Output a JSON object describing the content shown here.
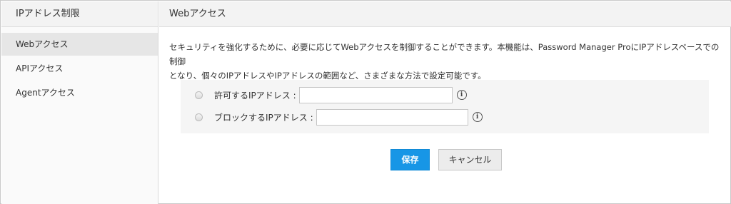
{
  "sidebar": {
    "title": "IPアドレス制限",
    "items": [
      {
        "label": "Webアクセス",
        "active": true
      },
      {
        "label": "APIアクセス",
        "active": false
      },
      {
        "label": "Agentアクセス",
        "active": false
      }
    ]
  },
  "main": {
    "title": "Webアクセス",
    "description_line1": "セキュリティを強化するために、必要に応じてWebアクセスを制御することができます。本機能は、Password Manager ProにIPアドレスベースでの制御",
    "description_line2": "となり、個々のIPアドレスやIPアドレスの範囲など、さまざまな方法で設定可能です。",
    "options": [
      {
        "label": "許可するIPアドレス :",
        "value": "",
        "selected": false
      },
      {
        "label": "ブロックするIPアドレス :",
        "value": "",
        "selected": false
      }
    ],
    "save_label": "保存",
    "cancel_label": "キャンセル"
  },
  "colors": {
    "primary_button": "#1796e6",
    "sidebar_active": "#e6e6e6",
    "header_bg": "#f3f3f3"
  }
}
